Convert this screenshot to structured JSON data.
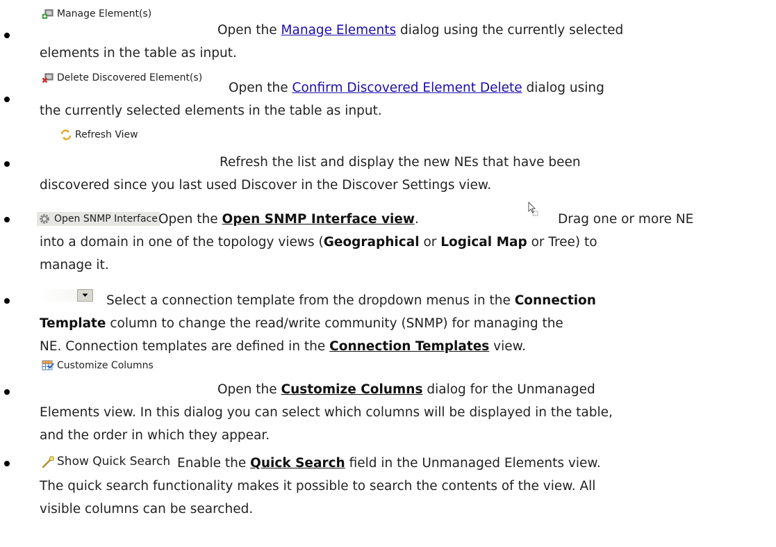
{
  "items": [
    {
      "button_label": "Manage Element(s)",
      "pre": "Open the ",
      "link": "Manage Elements",
      "post_line1": " dialog using the currently selected",
      "line2": "elements in the table as input."
    },
    {
      "button_label": "Delete Discovered Element(s)",
      "pre": "Open the ",
      "link": "Confirm Discovered Element Delete",
      "post_line1": " dialog using",
      "line2": "the currently selected elements in the table as input."
    },
    {
      "button_label": "Refresh View",
      "line1": "Refresh the list and display the new NEs that have been",
      "line2": "discovered since you last used Discover in the Discover Settings view."
    },
    {
      "button_label": "Open SNMP Interface",
      "pre": "Open the ",
      "link": "Open SNMP Interface view",
      "post": ".",
      "drag_text": "Drag one or more NE",
      "line2_pre": "into a domain in one of the topology views (",
      "geo": "Geographical",
      "or1": " or ",
      "logical": "Logical Map",
      "line2_post": " or Tree) to",
      "line3": "manage it."
    },
    {
      "line1_pre": "Select a connection template from the dropdown menus in the ",
      "connection": "Connection",
      "template": "Template",
      "line2_post": " column to change the read/write community (SNMP) for managing the",
      "line3_pre": "NE.  Connection templates are defined in the ",
      "link": "Connection Templates",
      "line3_post": " view."
    },
    {
      "button_label": "Customize Columns",
      "pre": "Open the ",
      "link": "Customize Columns",
      "post_line1": " dialog for the Unmanaged",
      "line2": "Elements view. In this dialog you can select which columns will be displayed in the table,",
      "line3": "and the order in which they appear."
    },
    {
      "button_label": "Show Quick Search",
      "pre": "Enable the ",
      "link": "Quick Search",
      "post_line1": " field in the Unmanaged Elements view.",
      "line2": "The quick search functionality makes it possible to search the contents of the view. All",
      "line3": "visible columns can be searched."
    }
  ]
}
